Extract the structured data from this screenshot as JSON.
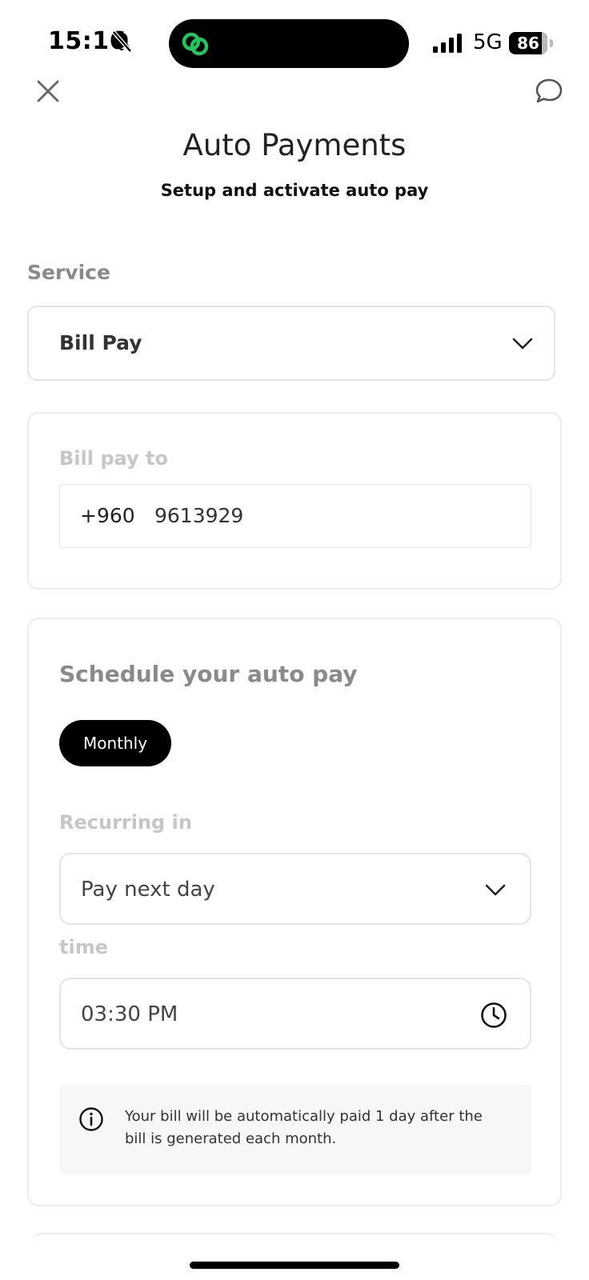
{
  "status_bar": {
    "time": "15:16",
    "network": "5G",
    "battery_level": "86",
    "battery_fraction": 0.86
  },
  "header": {
    "title": "Auto Payments",
    "subtitle": "Setup and activate auto pay",
    "close_icon": "close-icon",
    "chat_icon": "chat-bubble-icon"
  },
  "service": {
    "label": "Service",
    "selected": "Bill Pay"
  },
  "bill_pay_to": {
    "label": "Bill pay to",
    "country_code": "+960",
    "number": "9613929"
  },
  "schedule": {
    "title": "Schedule your auto pay",
    "frequency": "Monthly",
    "recurring_label": "Recurring in",
    "recurring_value": "Pay next day",
    "time_label": "time",
    "time_value": "03:30 PM",
    "info_text": "Your bill will be automatically paid 1 day after the bill is generated each month."
  },
  "colors": {
    "accent": "#000000",
    "label_gray": "#8a8a8a",
    "muted_label": "#c6c6c6",
    "app_icon_green": "#22c55e"
  }
}
